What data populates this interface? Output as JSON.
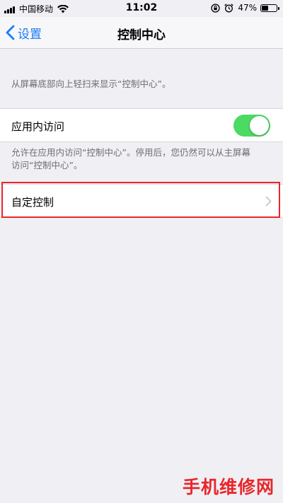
{
  "status_bar": {
    "carrier": "中国移动",
    "time": "11:02",
    "battery_percent": "47%",
    "battery_level": 0.47,
    "icons": [
      "signal-icon",
      "wifi-icon",
      "rotation-lock-icon",
      "alarm-icon",
      "battery-icon"
    ]
  },
  "nav": {
    "back_label": "设置",
    "title": "控制中心"
  },
  "main": {
    "intro_note": "从屏幕底部向上轻扫来显示“控制中心”。",
    "in_app_access": {
      "label": "应用内访问",
      "enabled": true
    },
    "in_app_note_line1": "允许在应用内访问“控制中心”。停用后，您仍然可以从主屏幕",
    "in_app_note_line2": "访问“控制中心”。",
    "customize_controls": {
      "label": "自定控制"
    }
  },
  "colors": {
    "ios_blue": "#1a7cf5",
    "toggle_green": "#4cd964",
    "highlight_red": "#e8262a",
    "background": "#efeff4"
  },
  "watermark": "手机维修网"
}
